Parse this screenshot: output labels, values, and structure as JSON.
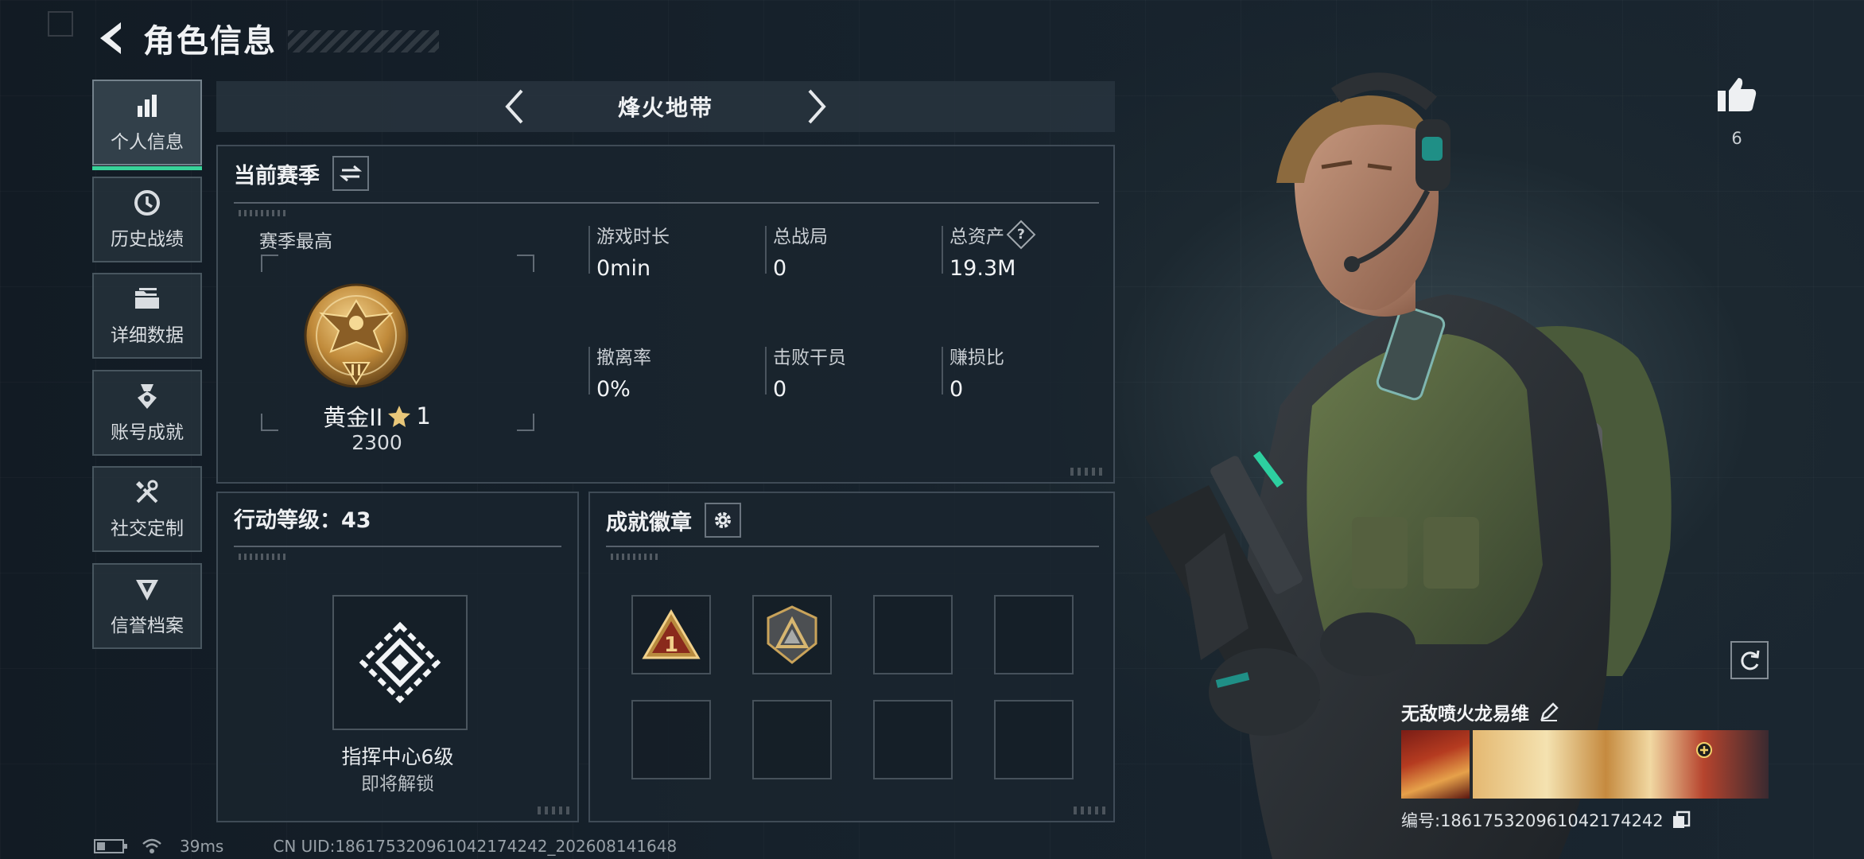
{
  "header": {
    "title": "角色信息"
  },
  "sidebar": {
    "items": [
      {
        "label": "个人信息",
        "icon": "bar-chart-icon",
        "active": true
      },
      {
        "label": "历史战绩",
        "icon": "history-clock-icon",
        "active": false
      },
      {
        "label": "详细数据",
        "icon": "folder-icon",
        "active": false
      },
      {
        "label": "账号成就",
        "icon": "achievement-medal-icon",
        "active": false
      },
      {
        "label": "社交定制",
        "icon": "tools-icon",
        "active": false
      },
      {
        "label": "信誉档案",
        "icon": "shield-credit-icon",
        "active": false
      }
    ]
  },
  "map_selector": {
    "current": "烽火地带"
  },
  "season": {
    "title": "当前赛季",
    "best_label": "赛季最高",
    "rank_name": "黄金II",
    "rank_stars": "1",
    "rank_score": "2300",
    "stats": [
      {
        "label": "游戏时长",
        "value": "0min"
      },
      {
        "label": "总战局",
        "value": "0"
      },
      {
        "label": "总资产",
        "value": "19.3M",
        "has_help": true,
        "help_symbol": "?"
      },
      {
        "label": "撤离率",
        "value": "0%"
      },
      {
        "label": "击败干员",
        "value": "0"
      },
      {
        "label": "赚损比",
        "value": "0"
      }
    ]
  },
  "action_level": {
    "title": "行动等级：43",
    "unlock_title": "指挥中心6级",
    "unlock_sub": "即将解锁"
  },
  "achievements": {
    "title": "成就徽章",
    "slots": [
      {
        "icon": "badge-triangle-1-icon",
        "filled": true,
        "badge_number": "1"
      },
      {
        "icon": "badge-shield-triangle-icon",
        "filled": true
      },
      {
        "filled": false
      },
      {
        "filled": false
      },
      {
        "filled": false
      },
      {
        "filled": false
      },
      {
        "filled": false
      },
      {
        "filled": false
      }
    ]
  },
  "profile": {
    "likes": "6",
    "player_name": "无敌喷火龙易维",
    "uid_text": "编号:186175320961042174242"
  },
  "status_bar": {
    "ping": "39ms",
    "cn_uid": "CN UID:186175320961042174242_202608141648"
  },
  "colors": {
    "accent_green": "#39d39a",
    "gold": "#c8973e"
  }
}
